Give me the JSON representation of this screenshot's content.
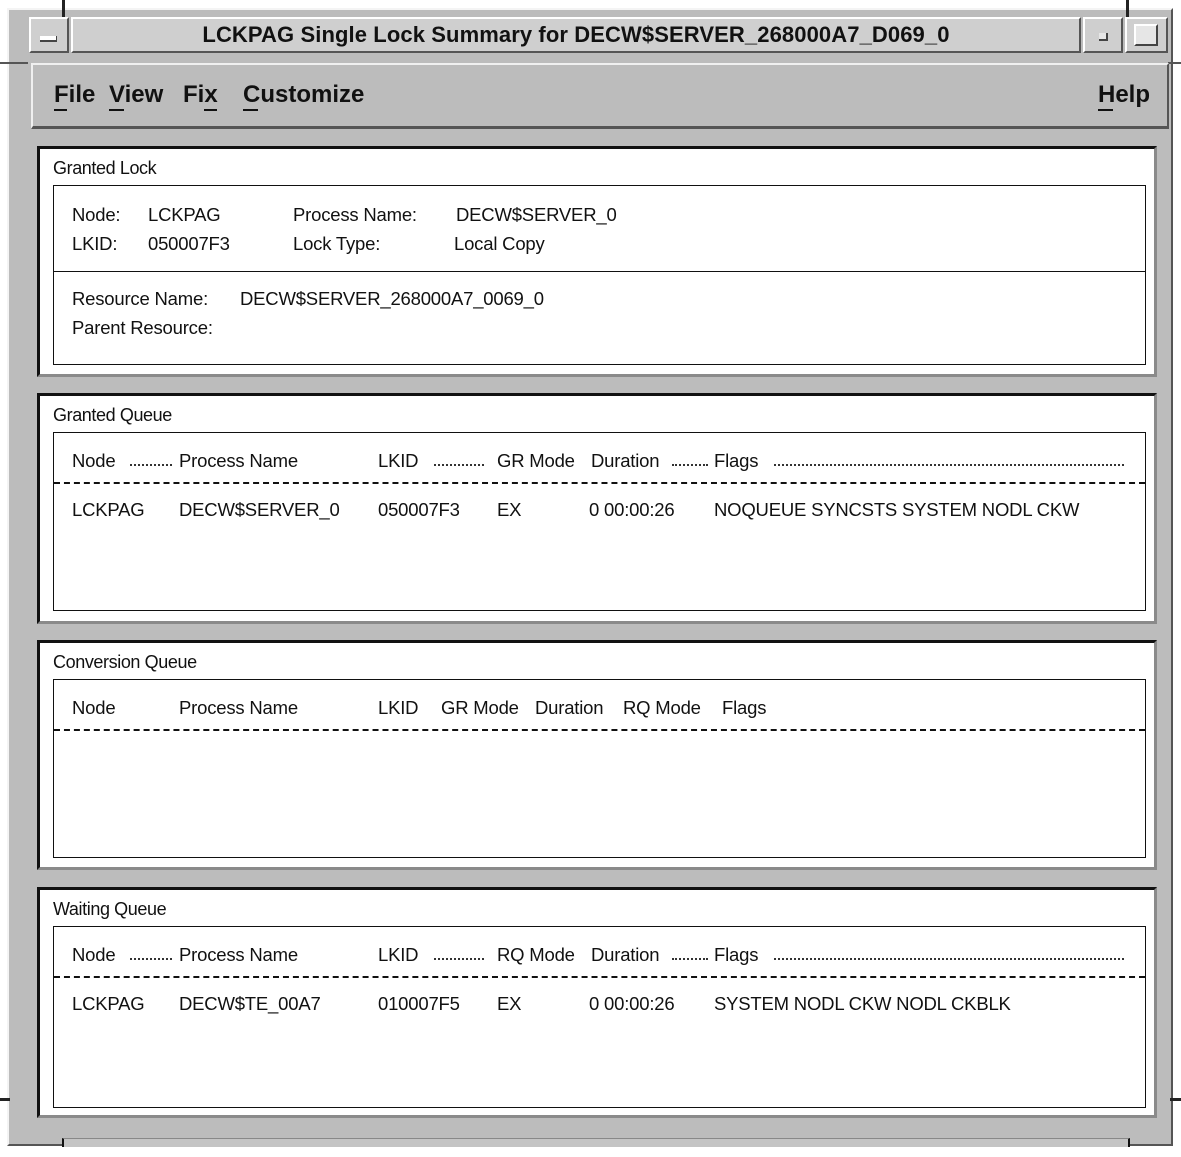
{
  "window": {
    "title": "LCKPAG Single Lock Summary for DECW$SERVER_268000A7_D069_0"
  },
  "menu": {
    "file": "File",
    "view": "View",
    "fix": "Fix",
    "customize": "Customize",
    "help": "Help"
  },
  "granted_lock": {
    "title": "Granted Lock",
    "node_label": "Node:",
    "node_value": "LCKPAG",
    "lkid_label": "LKID:",
    "lkid_value": "050007F3",
    "process_name_label": "Process Name:",
    "process_name_value": "DECW$SERVER_0",
    "lock_type_label": "Lock Type:",
    "lock_type_value": "Local Copy",
    "resource_name_label": "Resource Name:",
    "resource_name_value": "DECW$SERVER_268000A7_0069_0",
    "parent_resource_label": "Parent Resource:",
    "parent_resource_value": ""
  },
  "granted_queue": {
    "title": "Granted Queue",
    "columns": [
      "Node",
      "Process Name",
      "LKID",
      "GR Mode",
      "Duration",
      "Flags"
    ],
    "rows": [
      [
        "LCKPAG",
        "DECW$SERVER_0",
        "050007F3",
        "EX",
        "0 00:00:26",
        "NOQUEUE SYNCSTS SYSTEM NODL CKW"
      ]
    ]
  },
  "conversion_queue": {
    "title": "Conversion Queue",
    "columns": [
      "Node",
      "Process Name",
      "LKID",
      "GR Mode",
      "Duration",
      "RQ Mode",
      "Flags"
    ],
    "rows": []
  },
  "waiting_queue": {
    "title": "Waiting Queue",
    "columns": [
      "Node",
      "Process Name",
      "LKID",
      "RQ Mode",
      "Duration",
      "Flags"
    ],
    "rows": [
      [
        "LCKPAG",
        "DECW$TE_00A7",
        "010007F5",
        "EX",
        "0 00:00:26",
        "SYSTEM NODL CKW NODL CKBLK"
      ]
    ]
  }
}
